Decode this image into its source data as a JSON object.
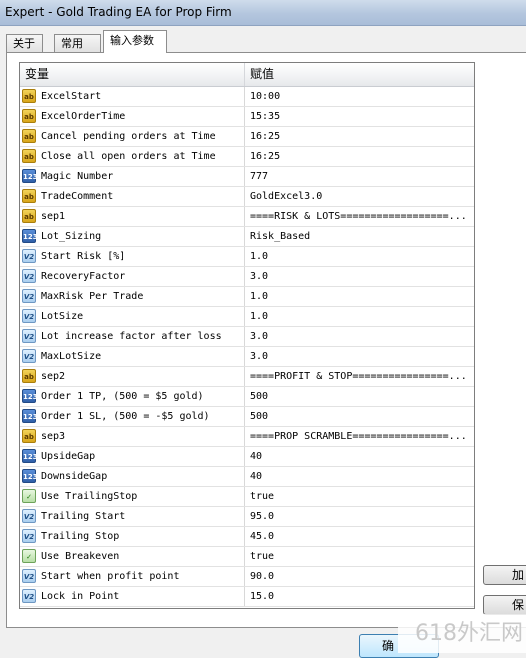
{
  "window": {
    "title": "Expert - Gold Trading EA for Prop Firm"
  },
  "tabs": [
    {
      "label": "关于"
    },
    {
      "label": "常用"
    },
    {
      "label": "输入参数"
    }
  ],
  "table": {
    "columns": [
      "变量",
      "赋值"
    ],
    "rows": [
      {
        "type": "string",
        "icon": "ab",
        "name": "ExcelStart",
        "value": "10:00"
      },
      {
        "type": "string",
        "icon": "ab",
        "name": "ExcelOrderTime",
        "value": "15:35"
      },
      {
        "type": "string",
        "icon": "ab",
        "name": "Cancel pending orders at Time",
        "value": "16:25"
      },
      {
        "type": "string",
        "icon": "ab",
        "name": "Close all open orders at Time",
        "value": "16:25"
      },
      {
        "type": "int",
        "icon": "123",
        "name": "Magic Number",
        "value": "777"
      },
      {
        "type": "string",
        "icon": "ab",
        "name": "TradeComment",
        "value": "GoldExcel3.0"
      },
      {
        "type": "string",
        "icon": "ab",
        "name": "sep1",
        "value": "====RISK & LOTS==================..."
      },
      {
        "type": "int",
        "icon": "123",
        "name": "Lot_Sizing",
        "value": "Risk_Based"
      },
      {
        "type": "double",
        "icon": "V2",
        "name": "Start Risk [%]",
        "value": "1.0"
      },
      {
        "type": "double",
        "icon": "V2",
        "name": "RecoveryFactor",
        "value": "3.0"
      },
      {
        "type": "double",
        "icon": "V2",
        "name": "MaxRisk Per Trade",
        "value": "1.0"
      },
      {
        "type": "double",
        "icon": "V2",
        "name": "LotSize",
        "value": "1.0"
      },
      {
        "type": "double",
        "icon": "V2",
        "name": "Lot increase factor after loss",
        "value": "3.0"
      },
      {
        "type": "double",
        "icon": "V2",
        "name": "MaxLotSize",
        "value": "3.0"
      },
      {
        "type": "string",
        "icon": "ab",
        "name": "sep2",
        "value": "====PROFIT & STOP================..."
      },
      {
        "type": "int",
        "icon": "123",
        "name": "Order 1 TP,  (500 = $5 gold)",
        "value": "500"
      },
      {
        "type": "int",
        "icon": "123",
        "name": "Order 1 SL,  (500 = -$5 gold)",
        "value": "500"
      },
      {
        "type": "string",
        "icon": "ab",
        "name": "sep3",
        "value": "====PROP SCRAMBLE================..."
      },
      {
        "type": "int",
        "icon": "123",
        "name": "UpsideGap",
        "value": "40"
      },
      {
        "type": "int",
        "icon": "123",
        "name": "DownsideGap",
        "value": "40"
      },
      {
        "type": "bool",
        "icon": "✓",
        "name": "Use TrailingStop",
        "value": "true"
      },
      {
        "type": "double",
        "icon": "V2",
        "name": "Trailing Start",
        "value": "95.0"
      },
      {
        "type": "double",
        "icon": "V2",
        "name": "Trailing Stop",
        "value": "45.0"
      },
      {
        "type": "bool",
        "icon": "✓",
        "name": "Use Breakeven",
        "value": "true"
      },
      {
        "type": "double",
        "icon": "V2",
        "name": "Start when profit point",
        "value": "90.0"
      },
      {
        "type": "double",
        "icon": "V2",
        "name": "Lock in Point",
        "value": "15.0"
      }
    ]
  },
  "buttons": {
    "load_label": "加",
    "save_label": "保",
    "ok_label": "确"
  },
  "watermark": "618外汇网"
}
